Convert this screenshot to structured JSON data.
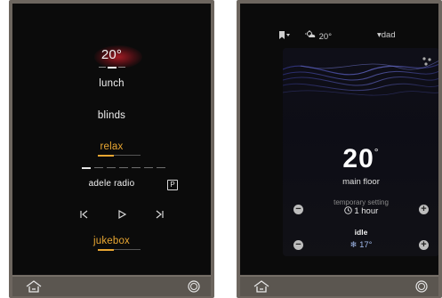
{
  "left_panel": {
    "temperature": "20°",
    "menu": [
      "lunch",
      "blinds",
      "relax"
    ],
    "now_playing": "adele radio",
    "source_badge": "P",
    "bottom_item": "jukebox"
  },
  "right_panel": {
    "topbar": {
      "weather_temp": "20°",
      "user": "▾dad"
    },
    "thermostat": {
      "temperature": "20",
      "degree": "°",
      "zone": "main floor",
      "mode_label": "temporary setting",
      "duration": "1 hour",
      "status": "idle",
      "setpoint": "17°"
    }
  },
  "colors": {
    "accent": "#e8a632",
    "screen_bg": "#0b0b0b",
    "frame": "#6d665f"
  },
  "icons": [
    "home-icon",
    "power-circle-icon",
    "previous-icon",
    "play-icon",
    "next-icon",
    "bookmark-icon",
    "weather-icon",
    "clock-icon",
    "snowflake-icon",
    "dots-icon"
  ]
}
